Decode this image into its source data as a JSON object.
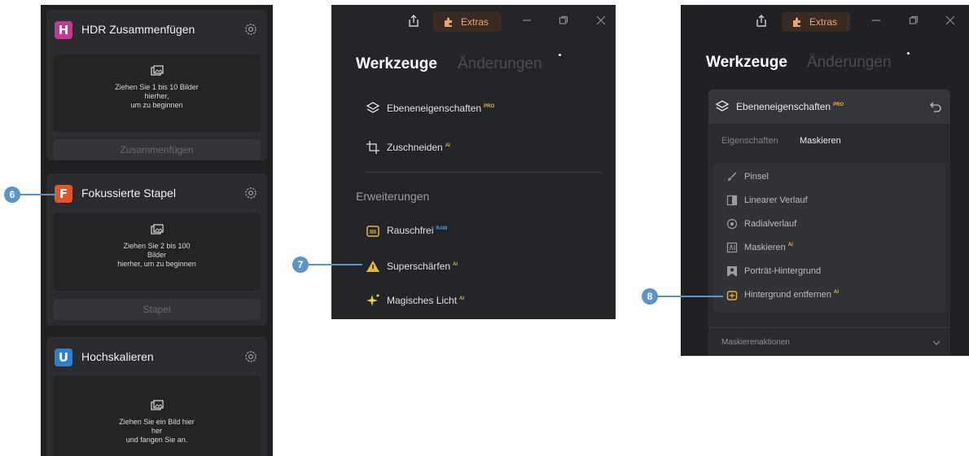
{
  "panel1": {
    "tools": [
      {
        "title": "HDR Zusammenfügen",
        "logo_letter": "H",
        "logo_color": "#c23a8f",
        "drop_text": "Ziehen Sie 1 bis 10 Bilder\nhierher,\num zu beginnen",
        "action": "Zusammenfügen"
      },
      {
        "title": "Fokussierte Stapel",
        "logo_letter": "F",
        "logo_color": "#e0552b",
        "drop_text": "Ziehen Sie 2 bis 100\nBilder\nhierher, um zu beginnen",
        "action": "Stapel"
      },
      {
        "title": "Hochskalieren",
        "logo_letter": "U",
        "logo_color": "#2f7fd1",
        "drop_text": "Ziehen Sie ein Bild hier\nher\nund fangen Sie an."
      }
    ]
  },
  "callouts": {
    "c6": "6",
    "c7": "7",
    "c8": "8",
    "color": "#5f95c6"
  },
  "titlebar": {
    "extras_label": "Extras",
    "accent": "#e9a56d"
  },
  "panel2": {
    "tab_active": "Werkzeuge",
    "tab_inactive": "Änderungen",
    "items": [
      {
        "label": "Ebeneneigenschaften",
        "badge": "PRO",
        "icon": "layers-icon"
      },
      {
        "label": "Zuschneiden",
        "badge": "AI",
        "icon": "crop-icon"
      }
    ],
    "section_title": "Erweiterungen",
    "extensions": [
      {
        "label": "Rauschfrei",
        "badge": "RAW",
        "icon": "noise-icon"
      },
      {
        "label": "Superschärfen",
        "badge": "AI",
        "icon": "sharpen-icon"
      },
      {
        "label": "Magisches Licht",
        "badge": "AI",
        "icon": "sparkle-icon"
      }
    ]
  },
  "panel3": {
    "tab_active": "Werkzeuge",
    "tab_inactive": "Änderungen",
    "header_label": "Ebeneneigenschaften",
    "header_badge": "PRO",
    "subtabs": [
      "Eigenschaften",
      "Maskieren"
    ],
    "mask_items": [
      {
        "label": "Pinsel",
        "icon": "brush-icon"
      },
      {
        "label": "Linearer Verlauf",
        "icon": "linear-gradient-icon"
      },
      {
        "label": "Radialverlauf",
        "icon": "radial-gradient-icon"
      },
      {
        "label": "Maskieren",
        "badge": "AI",
        "icon": "ai-mask-icon"
      },
      {
        "label": "Porträt-Hintergrund",
        "icon": "portrait-icon"
      },
      {
        "label": "Hintergrund entfernen",
        "badge": "AI",
        "icon": "remove-bg-icon"
      }
    ],
    "mask_actions_label": "Maskierenaktionen"
  }
}
